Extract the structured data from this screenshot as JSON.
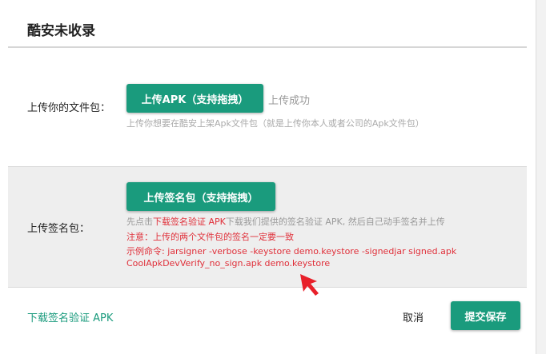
{
  "dialog": {
    "title": "酷安未收录"
  },
  "apk_upload": {
    "label": "上传你的文件包：",
    "button_label": "上传APK（支持拖拽）",
    "status": "上传成功",
    "hint": "上传你想要在酷安上架Apk文件包（就是上传你本人或者公司的Apk文件包）"
  },
  "signature_upload": {
    "label": "上传签名包：",
    "button_label": "上传签名包（支持拖拽）",
    "instruction_prefix": "先点击",
    "instruction_link": "下载签名验证 APK",
    "instruction_suffix": "下载我们提供的签名验证 APK, 然后自己动手签名并上传",
    "warning": "注意：上传的两个文件包的签名一定要一致",
    "example_line1": "示例命令: jarsigner -verbose -keystore demo.keystore -signedjar signed.apk",
    "example_line2": "CoolApkDevVerify_no_sign.apk demo.keystore"
  },
  "footer": {
    "download_link": "下载签名验证 APK",
    "cancel_label": "取消",
    "submit_label": "提交保存"
  },
  "colors": {
    "accent": "#1a9b7d",
    "warning": "#e0303a",
    "arrow": "#e8202a"
  },
  "icons": {
    "pointer": "red-arrow-icon"
  }
}
